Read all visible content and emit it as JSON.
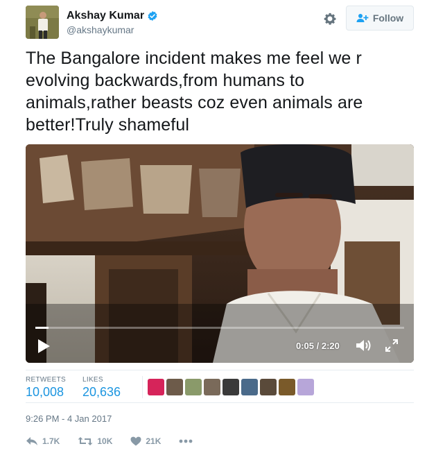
{
  "user": {
    "display_name": "Akshay Kumar",
    "handle": "@akshaykumar",
    "verified": true
  },
  "follow_button": {
    "label": "Follow"
  },
  "tweet": {
    "text": "The Bangalore incident makes me feel we r evolving backwards,from humans to animals,rather beasts coz even animals are better!Truly shameful"
  },
  "video": {
    "time": "0:05 / 2:20",
    "progress": 0.036
  },
  "stats": {
    "retweets_label": "RETWEETS",
    "retweets_value": "10,008",
    "likes_label": "LIKES",
    "likes_value": "20,636"
  },
  "liker_colors": [
    "#d6245a",
    "#6d5b4a",
    "#8a9a6a",
    "#7a6a5a",
    "#3a3a3a",
    "#4a6a8a",
    "#5a4a3a",
    "#7a5a2a",
    "#b7a6d9"
  ],
  "timestamp": "9:26 PM - 4 Jan 2017",
  "actions": {
    "reply_count": "1.7K",
    "retweet_count": "10K",
    "like_count": "21K"
  },
  "colors": {
    "accent": "#1b95e0",
    "muted": "#657786",
    "verified": "#1da1f2"
  }
}
